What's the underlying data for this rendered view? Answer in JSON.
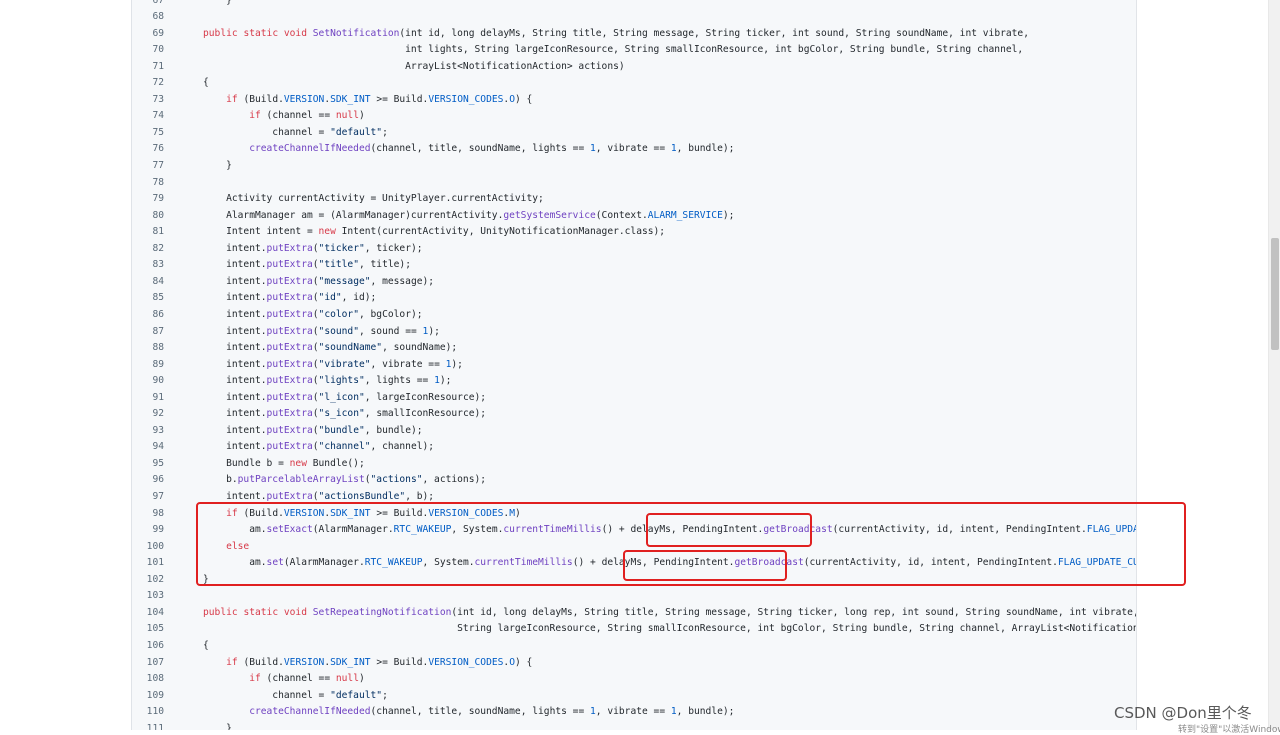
{
  "lines": [
    {
      "n": "67",
      "code": "    }"
    },
    {
      "n": "68",
      "code": ""
    },
    {
      "n": "69",
      "code": "public static void SetNotification(int id, long delayMs, String title, String message, String ticker, int sound, String soundName, int vibrate,"
    },
    {
      "n": "70",
      "code": "                                   int lights, String largeIconResource, String smallIconResource, int bgColor, String bundle, String channel,"
    },
    {
      "n": "71",
      "code": "                                   ArrayList<NotificationAction> actions)"
    },
    {
      "n": "72",
      "code": "{"
    },
    {
      "n": "73",
      "code": "    if (Build.VERSION.SDK_INT >= Build.VERSION_CODES.O) {"
    },
    {
      "n": "74",
      "code": "        if (channel == null)"
    },
    {
      "n": "75",
      "code": "            channel = \"default\";"
    },
    {
      "n": "76",
      "code": "        createChannelIfNeeded(channel, title, soundName, lights == 1, vibrate == 1, bundle);"
    },
    {
      "n": "77",
      "code": "    }"
    },
    {
      "n": "78",
      "code": ""
    },
    {
      "n": "79",
      "code": "    Activity currentActivity = UnityPlayer.currentActivity;"
    },
    {
      "n": "80",
      "code": "    AlarmManager am = (AlarmManager)currentActivity.getSystemService(Context.ALARM_SERVICE);"
    },
    {
      "n": "81",
      "code": "    Intent intent = new Intent(currentActivity, UnityNotificationManager.class);"
    },
    {
      "n": "82",
      "code": "    intent.putExtra(\"ticker\", ticker);"
    },
    {
      "n": "83",
      "code": "    intent.putExtra(\"title\", title);"
    },
    {
      "n": "84",
      "code": "    intent.putExtra(\"message\", message);"
    },
    {
      "n": "85",
      "code": "    intent.putExtra(\"id\", id);"
    },
    {
      "n": "86",
      "code": "    intent.putExtra(\"color\", bgColor);"
    },
    {
      "n": "87",
      "code": "    intent.putExtra(\"sound\", sound == 1);"
    },
    {
      "n": "88",
      "code": "    intent.putExtra(\"soundName\", soundName);"
    },
    {
      "n": "89",
      "code": "    intent.putExtra(\"vibrate\", vibrate == 1);"
    },
    {
      "n": "90",
      "code": "    intent.putExtra(\"lights\", lights == 1);"
    },
    {
      "n": "91",
      "code": "    intent.putExtra(\"l_icon\", largeIconResource);"
    },
    {
      "n": "92",
      "code": "    intent.putExtra(\"s_icon\", smallIconResource);"
    },
    {
      "n": "93",
      "code": "    intent.putExtra(\"bundle\", bundle);"
    },
    {
      "n": "94",
      "code": "    intent.putExtra(\"channel\", channel);"
    },
    {
      "n": "95",
      "code": "    Bundle b = new Bundle();"
    },
    {
      "n": "96",
      "code": "    b.putParcelableArrayList(\"actions\", actions);"
    },
    {
      "n": "97",
      "code": "    intent.putExtra(\"actionsBundle\", b);"
    },
    {
      "n": "98",
      "code": "    if (Build.VERSION.SDK_INT >= Build.VERSION_CODES.M)"
    },
    {
      "n": "99",
      "code": "        am.setExact(AlarmManager.RTC_WAKEUP, System.currentTimeMillis() + delayMs, PendingIntent.getBroadcast(currentActivity, id, intent, PendingIntent.FLAG_UPDATE_CURRENT));"
    },
    {
      "n": "100",
      "code": "    else"
    },
    {
      "n": "101",
      "code": "        am.set(AlarmManager.RTC_WAKEUP, System.currentTimeMillis() + delayMs, PendingIntent.getBroadcast(currentActivity, id, intent, PendingIntent.FLAG_UPDATE_CURRENT));"
    },
    {
      "n": "102",
      "code": "}"
    },
    {
      "n": "103",
      "code": ""
    },
    {
      "n": "104",
      "code": "public static void SetRepeatingNotification(int id, long delayMs, String title, String message, String ticker, long rep, int sound, String soundName, int vibrate, int lights,"
    },
    {
      "n": "105",
      "code": "                                            String largeIconResource, String smallIconResource, int bgColor, String bundle, String channel, ArrayList<NotificationAction> actions)"
    },
    {
      "n": "106",
      "code": "{"
    },
    {
      "n": "107",
      "code": "    if (Build.VERSION.SDK_INT >= Build.VERSION_CODES.O) {"
    },
    {
      "n": "108",
      "code": "        if (channel == null)"
    },
    {
      "n": "109",
      "code": "            channel = \"default\";"
    },
    {
      "n": "110",
      "code": "        createChannelIfNeeded(channel, title, soundName, lights == 1, vibrate == 1, bundle);"
    },
    {
      "n": "111",
      "code": "    }"
    }
  ],
  "watermark": {
    "text": "CSDN @Don里个冬",
    "sub": "转到\"设置\"以激活Windows"
  },
  "colors": {
    "keyword": "#d73a49",
    "method": "#6f42c1",
    "constant": "#005cc5",
    "string": "#032f62",
    "plain": "#24292e",
    "highlight_box": "#e02020"
  }
}
